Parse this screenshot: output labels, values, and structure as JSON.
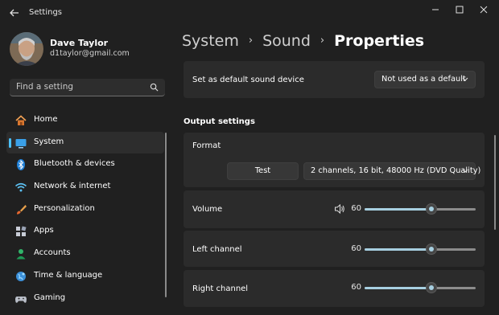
{
  "window": {
    "title": "Settings"
  },
  "user": {
    "name": "Dave Taylor",
    "email": "d1taylor@gmail.com"
  },
  "search": {
    "placeholder": "Find a setting"
  },
  "nav": [
    {
      "label": "Home",
      "icon": "home-icon"
    },
    {
      "label": "System",
      "icon": "system-icon",
      "active": true
    },
    {
      "label": "Bluetooth & devices",
      "icon": "bluetooth-icon"
    },
    {
      "label": "Network & internet",
      "icon": "network-icon"
    },
    {
      "label": "Personalization",
      "icon": "brush-icon"
    },
    {
      "label": "Apps",
      "icon": "apps-icon"
    },
    {
      "label": "Accounts",
      "icon": "accounts-icon"
    },
    {
      "label": "Time & language",
      "icon": "globe-icon"
    },
    {
      "label": "Gaming",
      "icon": "gaming-icon"
    }
  ],
  "breadcrumb": {
    "first": "System",
    "second": "Sound",
    "current": "Properties"
  },
  "default_device": {
    "label": "Set as default sound device",
    "value": "Not used as a default"
  },
  "output": {
    "heading": "Output settings",
    "format_label": "Format",
    "test_label": "Test",
    "format_value": "2 channels, 16 bit, 48000 Hz (DVD Quality)"
  },
  "sliders": {
    "volume": {
      "label": "Volume",
      "value": "60",
      "level": 0.6
    },
    "left": {
      "label": "Left channel",
      "value": "60",
      "level": 0.6
    },
    "right": {
      "label": "Right channel",
      "value": "60",
      "level": 0.6
    }
  },
  "colors": {
    "accent": "#4cc2ff",
    "slider_fill": "#a7cfe0",
    "background": "#202020",
    "card": "#2b2b2b"
  }
}
